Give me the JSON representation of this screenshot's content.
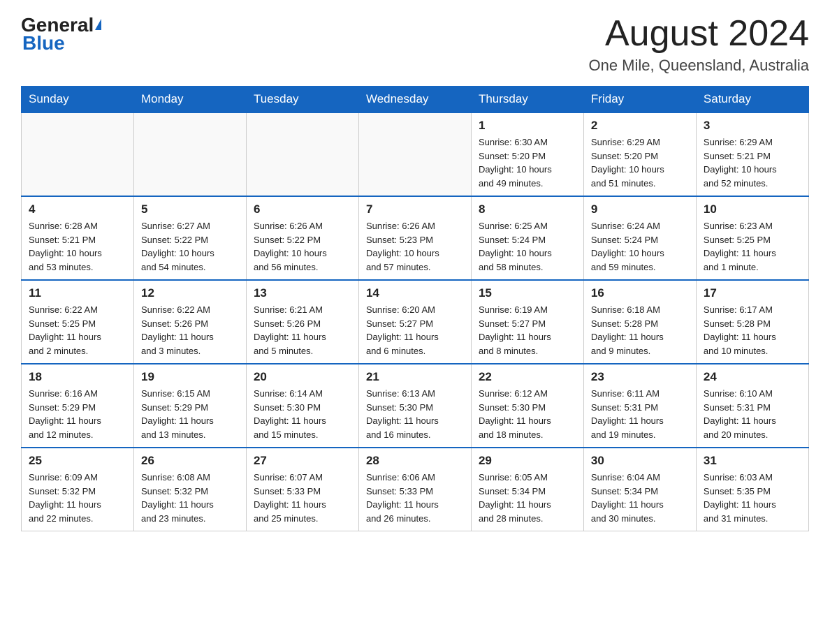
{
  "logo": {
    "text_general": "General",
    "text_blue": "Blue",
    "triangle": "▶"
  },
  "title": "August 2024",
  "subtitle": "One Mile, Queensland, Australia",
  "headers": [
    "Sunday",
    "Monday",
    "Tuesday",
    "Wednesday",
    "Thursday",
    "Friday",
    "Saturday"
  ],
  "weeks": [
    [
      {
        "day": "",
        "info": ""
      },
      {
        "day": "",
        "info": ""
      },
      {
        "day": "",
        "info": ""
      },
      {
        "day": "",
        "info": ""
      },
      {
        "day": "1",
        "info": "Sunrise: 6:30 AM\nSunset: 5:20 PM\nDaylight: 10 hours\nand 49 minutes."
      },
      {
        "day": "2",
        "info": "Sunrise: 6:29 AM\nSunset: 5:20 PM\nDaylight: 10 hours\nand 51 minutes."
      },
      {
        "day": "3",
        "info": "Sunrise: 6:29 AM\nSunset: 5:21 PM\nDaylight: 10 hours\nand 52 minutes."
      }
    ],
    [
      {
        "day": "4",
        "info": "Sunrise: 6:28 AM\nSunset: 5:21 PM\nDaylight: 10 hours\nand 53 minutes."
      },
      {
        "day": "5",
        "info": "Sunrise: 6:27 AM\nSunset: 5:22 PM\nDaylight: 10 hours\nand 54 minutes."
      },
      {
        "day": "6",
        "info": "Sunrise: 6:26 AM\nSunset: 5:22 PM\nDaylight: 10 hours\nand 56 minutes."
      },
      {
        "day": "7",
        "info": "Sunrise: 6:26 AM\nSunset: 5:23 PM\nDaylight: 10 hours\nand 57 minutes."
      },
      {
        "day": "8",
        "info": "Sunrise: 6:25 AM\nSunset: 5:24 PM\nDaylight: 10 hours\nand 58 minutes."
      },
      {
        "day": "9",
        "info": "Sunrise: 6:24 AM\nSunset: 5:24 PM\nDaylight: 10 hours\nand 59 minutes."
      },
      {
        "day": "10",
        "info": "Sunrise: 6:23 AM\nSunset: 5:25 PM\nDaylight: 11 hours\nand 1 minute."
      }
    ],
    [
      {
        "day": "11",
        "info": "Sunrise: 6:22 AM\nSunset: 5:25 PM\nDaylight: 11 hours\nand 2 minutes."
      },
      {
        "day": "12",
        "info": "Sunrise: 6:22 AM\nSunset: 5:26 PM\nDaylight: 11 hours\nand 3 minutes."
      },
      {
        "day": "13",
        "info": "Sunrise: 6:21 AM\nSunset: 5:26 PM\nDaylight: 11 hours\nand 5 minutes."
      },
      {
        "day": "14",
        "info": "Sunrise: 6:20 AM\nSunset: 5:27 PM\nDaylight: 11 hours\nand 6 minutes."
      },
      {
        "day": "15",
        "info": "Sunrise: 6:19 AM\nSunset: 5:27 PM\nDaylight: 11 hours\nand 8 minutes."
      },
      {
        "day": "16",
        "info": "Sunrise: 6:18 AM\nSunset: 5:28 PM\nDaylight: 11 hours\nand 9 minutes."
      },
      {
        "day": "17",
        "info": "Sunrise: 6:17 AM\nSunset: 5:28 PM\nDaylight: 11 hours\nand 10 minutes."
      }
    ],
    [
      {
        "day": "18",
        "info": "Sunrise: 6:16 AM\nSunset: 5:29 PM\nDaylight: 11 hours\nand 12 minutes."
      },
      {
        "day": "19",
        "info": "Sunrise: 6:15 AM\nSunset: 5:29 PM\nDaylight: 11 hours\nand 13 minutes."
      },
      {
        "day": "20",
        "info": "Sunrise: 6:14 AM\nSunset: 5:30 PM\nDaylight: 11 hours\nand 15 minutes."
      },
      {
        "day": "21",
        "info": "Sunrise: 6:13 AM\nSunset: 5:30 PM\nDaylight: 11 hours\nand 16 minutes."
      },
      {
        "day": "22",
        "info": "Sunrise: 6:12 AM\nSunset: 5:30 PM\nDaylight: 11 hours\nand 18 minutes."
      },
      {
        "day": "23",
        "info": "Sunrise: 6:11 AM\nSunset: 5:31 PM\nDaylight: 11 hours\nand 19 minutes."
      },
      {
        "day": "24",
        "info": "Sunrise: 6:10 AM\nSunset: 5:31 PM\nDaylight: 11 hours\nand 20 minutes."
      }
    ],
    [
      {
        "day": "25",
        "info": "Sunrise: 6:09 AM\nSunset: 5:32 PM\nDaylight: 11 hours\nand 22 minutes."
      },
      {
        "day": "26",
        "info": "Sunrise: 6:08 AM\nSunset: 5:32 PM\nDaylight: 11 hours\nand 23 minutes."
      },
      {
        "day": "27",
        "info": "Sunrise: 6:07 AM\nSunset: 5:33 PM\nDaylight: 11 hours\nand 25 minutes."
      },
      {
        "day": "28",
        "info": "Sunrise: 6:06 AM\nSunset: 5:33 PM\nDaylight: 11 hours\nand 26 minutes."
      },
      {
        "day": "29",
        "info": "Sunrise: 6:05 AM\nSunset: 5:34 PM\nDaylight: 11 hours\nand 28 minutes."
      },
      {
        "day": "30",
        "info": "Sunrise: 6:04 AM\nSunset: 5:34 PM\nDaylight: 11 hours\nand 30 minutes."
      },
      {
        "day": "31",
        "info": "Sunrise: 6:03 AM\nSunset: 5:35 PM\nDaylight: 11 hours\nand 31 minutes."
      }
    ]
  ]
}
